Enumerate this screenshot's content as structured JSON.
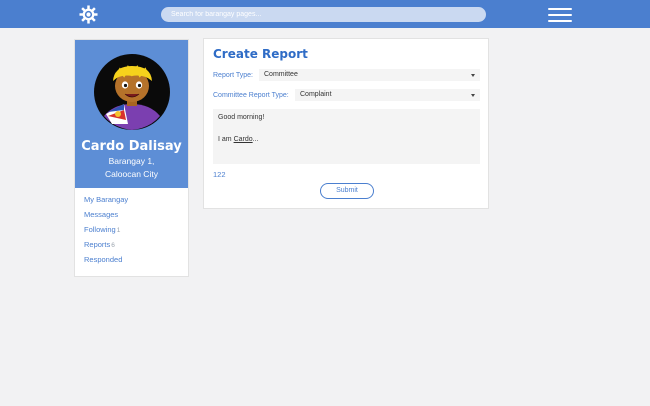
{
  "header": {
    "search_placeholder": "Search for barangay pages...",
    "logo_icon": "gear-logo-icon",
    "menu_icon": "hamburger-menu-icon"
  },
  "profile": {
    "name": "Cardo Dalisay",
    "location_line1": "Barangay 1,",
    "location_line2": "Caloocan City"
  },
  "nav": {
    "items": [
      {
        "label": "My Barangay",
        "count": ""
      },
      {
        "label": "Messages",
        "count": ""
      },
      {
        "label": "Following",
        "count": "1"
      },
      {
        "label": "Reports",
        "count": "6"
      },
      {
        "label": "Responded",
        "count": ""
      }
    ]
  },
  "report": {
    "title": "Create Report",
    "report_type_label": "Report Type:",
    "report_type_value": "Committee",
    "committee_type_label": "Committee Report Type:",
    "committee_type_value": "Complaint",
    "message_line1": "Good morning!",
    "message_line2_prefix": "I am ",
    "message_line2_name": "Cardo",
    "message_line2_suffix": "...",
    "char_count": "122",
    "submit_label": "Submit"
  },
  "colors": {
    "header_bg": "#4b7fcf",
    "profile_bg": "#5d8ed6",
    "accent": "#2f6cc6",
    "page_bg": "#f2f2f3"
  }
}
